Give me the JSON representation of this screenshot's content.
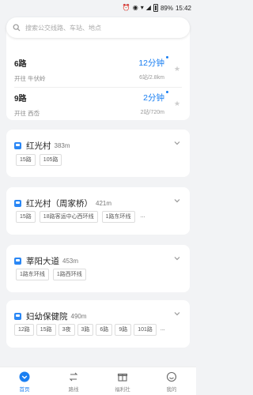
{
  "status": {
    "battery": "89%",
    "time": "15:42"
  },
  "search": {
    "placeholder": "搜索公交线路、车站、地点"
  },
  "top_lines": [
    {
      "name": "6路",
      "dest": "开往 牛伏岭",
      "eta": "12分钟",
      "meta": "6站/2.8km"
    },
    {
      "name": "9路",
      "dest": "开往 西岙",
      "eta": "2分钟",
      "meta": "2站/720m"
    }
  ],
  "stops": [
    {
      "name": "红光村",
      "dist": "383m",
      "lines": [
        "15路",
        "105路"
      ],
      "more": ""
    },
    {
      "name": "红光村（周家桥）",
      "dist": "421m",
      "lines": [
        "15路",
        "18路客运中心西环线",
        "1路东环线"
      ],
      "more": "..."
    },
    {
      "name": "莘阳大道",
      "dist": "453m",
      "lines": [
        "1路东环线",
        "1路西环线"
      ],
      "more": ""
    },
    {
      "name": "妇幼保健院",
      "dist": "490m",
      "lines": [
        "12路",
        "15路",
        "3夜",
        "3路",
        "6路",
        "9路",
        "101路"
      ],
      "more": "..."
    }
  ],
  "tabs": [
    {
      "label": "首页",
      "icon": "home-icon"
    },
    {
      "label": "路线",
      "icon": "route-icon"
    },
    {
      "label": "福利社",
      "icon": "gift-icon"
    },
    {
      "label": "我的",
      "icon": "profile-icon"
    }
  ],
  "colors": {
    "accent": "#1a7ff2",
    "background": "#f2f3f5"
  }
}
